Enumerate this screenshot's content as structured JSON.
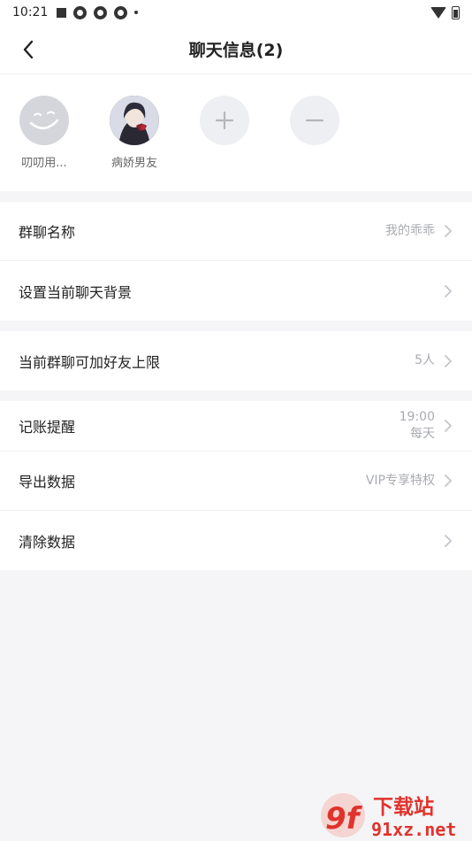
{
  "status_bar": {
    "time": "10:21"
  },
  "header": {
    "title": "聊天信息(2)"
  },
  "members": [
    {
      "name": "叨叨用..."
    },
    {
      "name": "病娇男友"
    }
  ],
  "settings": {
    "group1": [
      {
        "label": "群聊名称",
        "value": "我的乖乖"
      },
      {
        "label": "设置当前聊天背景",
        "value": ""
      }
    ],
    "group2": [
      {
        "label": "当前群聊可加好友上限",
        "value": "5人"
      }
    ],
    "group3": [
      {
        "label": "记账提醒",
        "value_line1": "19:00",
        "value_line2": "每天"
      },
      {
        "label": "导出数据",
        "value": "VIP专享特权"
      },
      {
        "label": "清除数据",
        "value": ""
      }
    ]
  },
  "watermark": {
    "logo": "9f",
    "text_top": "下载站",
    "text_bottom": "91xz.net"
  },
  "colors": {
    "background": "#f5f5f7",
    "muted_text": "#a9abb0",
    "watermark_red": "#e0332c"
  }
}
